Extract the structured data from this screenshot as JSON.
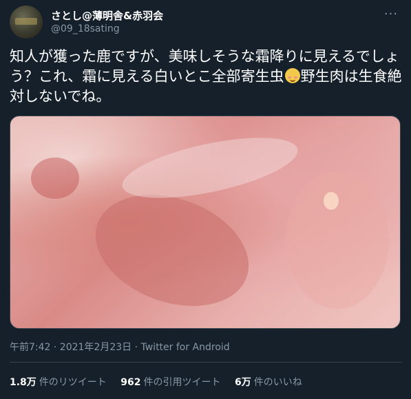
{
  "author": {
    "display_name": "さとし@薄明舎&赤羽会",
    "handle": "@09_18sating"
  },
  "tweet": {
    "text_before_emoji": "知人が獲った鹿ですが、美味しそうな霜降りに見えるでしょう？これ、霜に見える白いとこ全部寄生虫",
    "emoji_icon": "smiling-face-with-blush-icon",
    "text_after_emoji": "野生肉は生食絶対しないでね。"
  },
  "meta": {
    "timestamp": "午前7:42 · 2021年2月23日 · Twitter for Android"
  },
  "stats": [
    {
      "value": "1.8万",
      "label": "件のリツイート"
    },
    {
      "value": "962",
      "label": "件の引用ツイート"
    },
    {
      "value": "6万",
      "label": "件のいいね"
    }
  ],
  "colors": {
    "background": "#15202b",
    "secondary_text": "#8899a6",
    "border": "#38444d"
  }
}
